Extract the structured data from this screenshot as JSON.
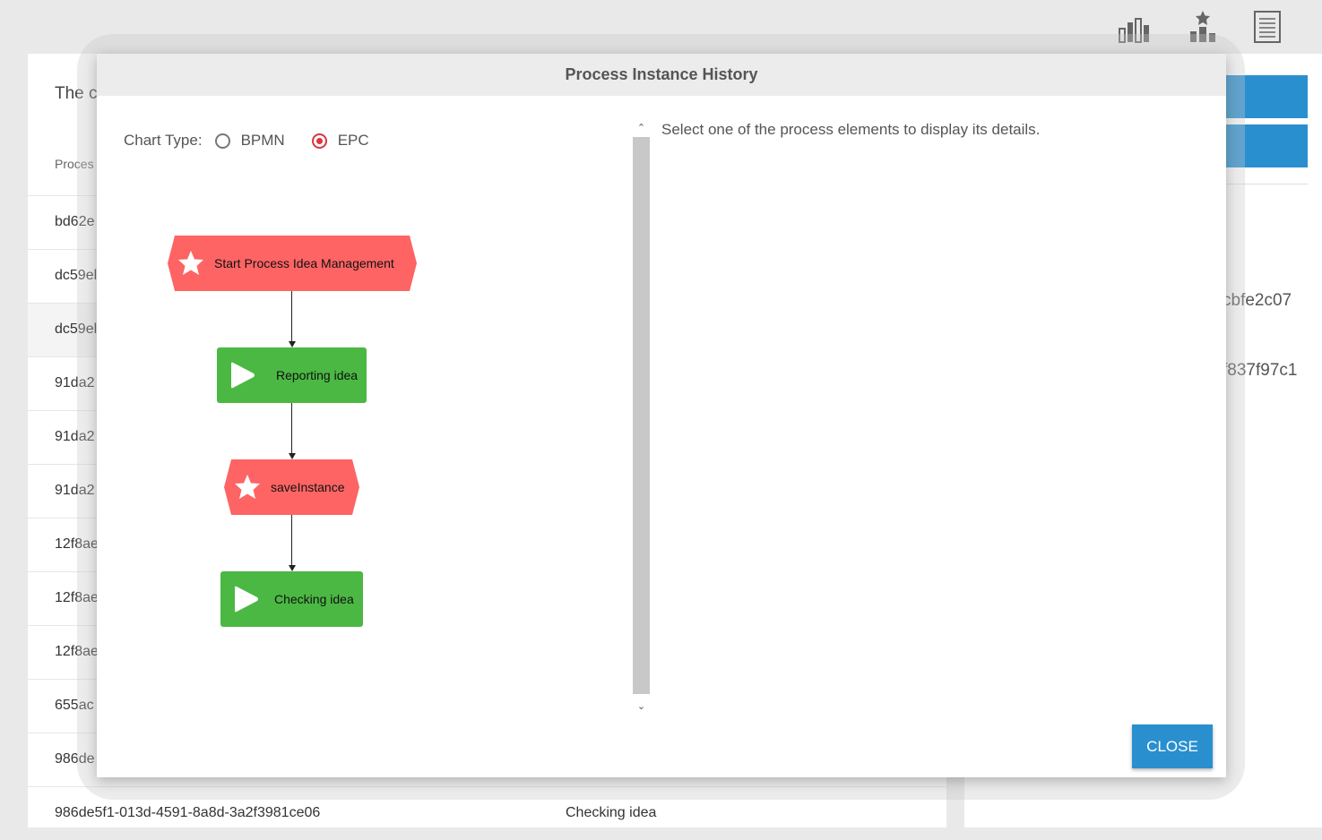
{
  "toolbar": {
    "icons": [
      "bar-chart-icon",
      "ranking-icon",
      "document-icon"
    ]
  },
  "background": {
    "title": "The c",
    "column_header": "Proces",
    "rows": [
      {
        "id": "bd62e",
        "value": ""
      },
      {
        "id": "dc59el",
        "value": ""
      },
      {
        "id": "dc59el",
        "value": ""
      },
      {
        "id": "91da2",
        "value": ""
      },
      {
        "id": "91da2",
        "value": ""
      },
      {
        "id": "91da2",
        "value": ""
      },
      {
        "id": "12f8ae",
        "value": ""
      },
      {
        "id": "12f8ae",
        "value": ""
      },
      {
        "id": "12f8ae",
        "value": ""
      },
      {
        "id": "655ac",
        "value": ""
      },
      {
        "id": "986de",
        "value": ""
      },
      {
        "id": "986de5f1-013d-4591-8a8d-3a2f3981ce06",
        "value": "Checking idea"
      }
    ],
    "right_values": [
      "cbfe2c07",
      "f837f97c1"
    ]
  },
  "modal": {
    "title": "Process Instance History",
    "chart_type_label": "Chart Type:",
    "options": [
      {
        "label": "BPMN",
        "checked": false
      },
      {
        "label": "EPC",
        "checked": true
      }
    ],
    "nodes": [
      {
        "type": "event",
        "label": "Start Process Idea Management"
      },
      {
        "type": "activity",
        "label": "Reporting idea"
      },
      {
        "type": "event",
        "label": "saveInstance"
      },
      {
        "type": "activity",
        "label": "Checking idea"
      }
    ],
    "colors": {
      "event": "#fe6464",
      "activity": "#4bb844",
      "accent": "#2a8fcf",
      "radio_checked": "#d9363e"
    },
    "detail_placeholder": "Select one of the process elements to display its details.",
    "close_label": "CLOSE"
  }
}
